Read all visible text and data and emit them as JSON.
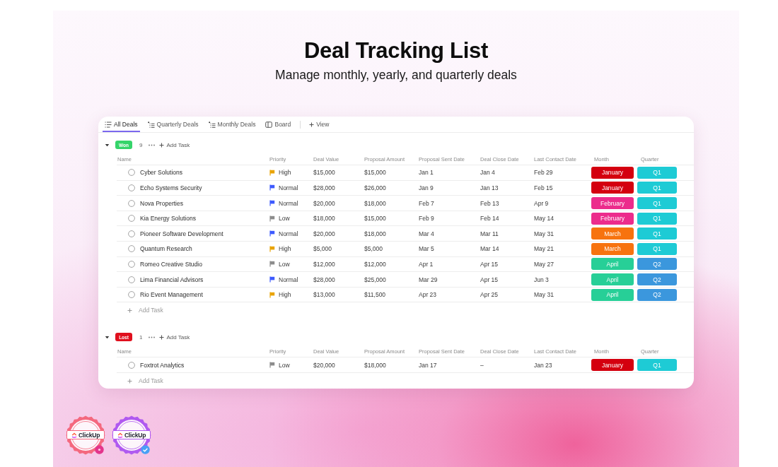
{
  "header": {
    "title": "Deal Tracking List",
    "subtitle": "Manage monthly, yearly, and quarterly deals"
  },
  "tabs": [
    {
      "label": "All Deals",
      "kind": "list",
      "selected": true
    },
    {
      "label": "Quarterly Deals",
      "kind": "hierarchy",
      "selected": false
    },
    {
      "label": "Monthly Deals",
      "kind": "hierarchy",
      "selected": false
    },
    {
      "label": "Board",
      "kind": "board",
      "selected": false
    }
  ],
  "add_view_button": "View",
  "groups": [
    {
      "label": "Won",
      "color": "#35d46a",
      "count": "9",
      "expanded": true,
      "add_task_button": "Add Task",
      "columns": [
        "Name",
        "Priority",
        "Deal Value",
        "Proposal Amount",
        "Proposal Sent Date",
        "Deal Close Date",
        "Last Contact Date",
        "Month",
        "Quarter"
      ],
      "rows": [
        {
          "name": "Cyber Solutions",
          "priority": {
            "label": "High",
            "color": "#e9a300"
          },
          "deal_value": "$15,000",
          "proposal_amount": "$15,000",
          "proposal_sent_date": "Jan 1",
          "deal_close_date": "Jan 4",
          "last_contact_date": "Feb 29",
          "month": {
            "label": "January",
            "color": "#d4000f"
          },
          "quarter": {
            "label": "Q1",
            "color": "#1ecbd5"
          }
        },
        {
          "name": "Echo Systems Security",
          "priority": {
            "label": "Normal",
            "color": "#3d5afe"
          },
          "deal_value": "$28,000",
          "proposal_amount": "$26,000",
          "proposal_sent_date": "Jan 9",
          "deal_close_date": "Jan 13",
          "last_contact_date": "Feb 15",
          "month": {
            "label": "January",
            "color": "#d4000f"
          },
          "quarter": {
            "label": "Q1",
            "color": "#1ecbd5"
          }
        },
        {
          "name": "Nova Properties",
          "priority": {
            "label": "Normal",
            "color": "#3d5afe"
          },
          "deal_value": "$20,000",
          "proposal_amount": "$18,000",
          "proposal_sent_date": "Feb 7",
          "deal_close_date": "Feb 13",
          "last_contact_date": "Apr 9",
          "month": {
            "label": "February",
            "color": "#ec2c8c"
          },
          "quarter": {
            "label": "Q1",
            "color": "#1ecbd5"
          }
        },
        {
          "name": "Kia Energy Solutions",
          "priority": {
            "label": "Low",
            "color": "#8c8c8c"
          },
          "deal_value": "$18,000",
          "proposal_amount": "$15,000",
          "proposal_sent_date": "Feb 9",
          "deal_close_date": "Feb 14",
          "last_contact_date": "May 14",
          "month": {
            "label": "February",
            "color": "#ec2c8c"
          },
          "quarter": {
            "label": "Q1",
            "color": "#1ecbd5"
          }
        },
        {
          "name": "Pioneer Software Development",
          "priority": {
            "label": "Normal",
            "color": "#3d5afe"
          },
          "deal_value": "$20,000",
          "proposal_amount": "$18,000",
          "proposal_sent_date": "Mar 4",
          "deal_close_date": "Mar 11",
          "last_contact_date": "May 31",
          "month": {
            "label": "March",
            "color": "#f7730f"
          },
          "quarter": {
            "label": "Q1",
            "color": "#1ecbd5"
          }
        },
        {
          "name": "Quantum Research",
          "priority": {
            "label": "High",
            "color": "#e9a300"
          },
          "deal_value": "$5,000",
          "proposal_amount": "$5,000",
          "proposal_sent_date": "Mar 5",
          "deal_close_date": "Mar 14",
          "last_contact_date": "May 21",
          "month": {
            "label": "March",
            "color": "#f7730f"
          },
          "quarter": {
            "label": "Q1",
            "color": "#1ecbd5"
          }
        },
        {
          "name": "Romeo Creative Studio",
          "priority": {
            "label": "Low",
            "color": "#8c8c8c"
          },
          "deal_value": "$12,000",
          "proposal_amount": "$12,000",
          "proposal_sent_date": "Apr 1",
          "deal_close_date": "Apr 15",
          "last_contact_date": "May 27",
          "month": {
            "label": "April",
            "color": "#27cf97"
          },
          "quarter": {
            "label": "Q2",
            "color": "#3b97dd"
          }
        },
        {
          "name": "Lima Financial Advisors",
          "priority": {
            "label": "Normal",
            "color": "#3d5afe"
          },
          "deal_value": "$28,000",
          "proposal_amount": "$25,000",
          "proposal_sent_date": "Mar 29",
          "deal_close_date": "Apr 15",
          "last_contact_date": "Jun 3",
          "month": {
            "label": "April",
            "color": "#27cf97"
          },
          "quarter": {
            "label": "Q2",
            "color": "#3b97dd"
          }
        },
        {
          "name": "Rio Event Management",
          "priority": {
            "label": "High",
            "color": "#e9a300"
          },
          "deal_value": "$13,000",
          "proposal_amount": "$11,500",
          "proposal_sent_date": "Apr 23",
          "deal_close_date": "Apr 25",
          "last_contact_date": "May 31",
          "month": {
            "label": "April",
            "color": "#27cf97"
          },
          "quarter": {
            "label": "Q2",
            "color": "#3b97dd"
          }
        }
      ],
      "add_task_row": "Add Task"
    },
    {
      "label": "Lost",
      "color": "#e0101e",
      "count": "1",
      "expanded": true,
      "add_task_button": "Add Task",
      "columns": [
        "Name",
        "Priority",
        "Deal Value",
        "Proposal Amount",
        "Proposal Sent Date",
        "Deal Close Date",
        "Last Contact Date",
        "Month",
        "Quarter"
      ],
      "rows": [
        {
          "name": "Foxtrot Analytics",
          "priority": {
            "label": "Low",
            "color": "#8c8c8c"
          },
          "deal_value": "$20,000",
          "proposal_amount": "$18,000",
          "proposal_sent_date": "Jan 17",
          "deal_close_date": "–",
          "last_contact_date": "Jan 23",
          "month": {
            "label": "January",
            "color": "#d4000f"
          },
          "quarter": {
            "label": "Q1",
            "color": "#1ecbd5"
          }
        }
      ],
      "add_task_row": "Add Task"
    }
  ],
  "badges": [
    {
      "brand": "ClickUp",
      "color": "#f4697f",
      "kind": "dot"
    },
    {
      "brand": "ClickUp",
      "color": "#b05af0",
      "kind": "check"
    }
  ]
}
